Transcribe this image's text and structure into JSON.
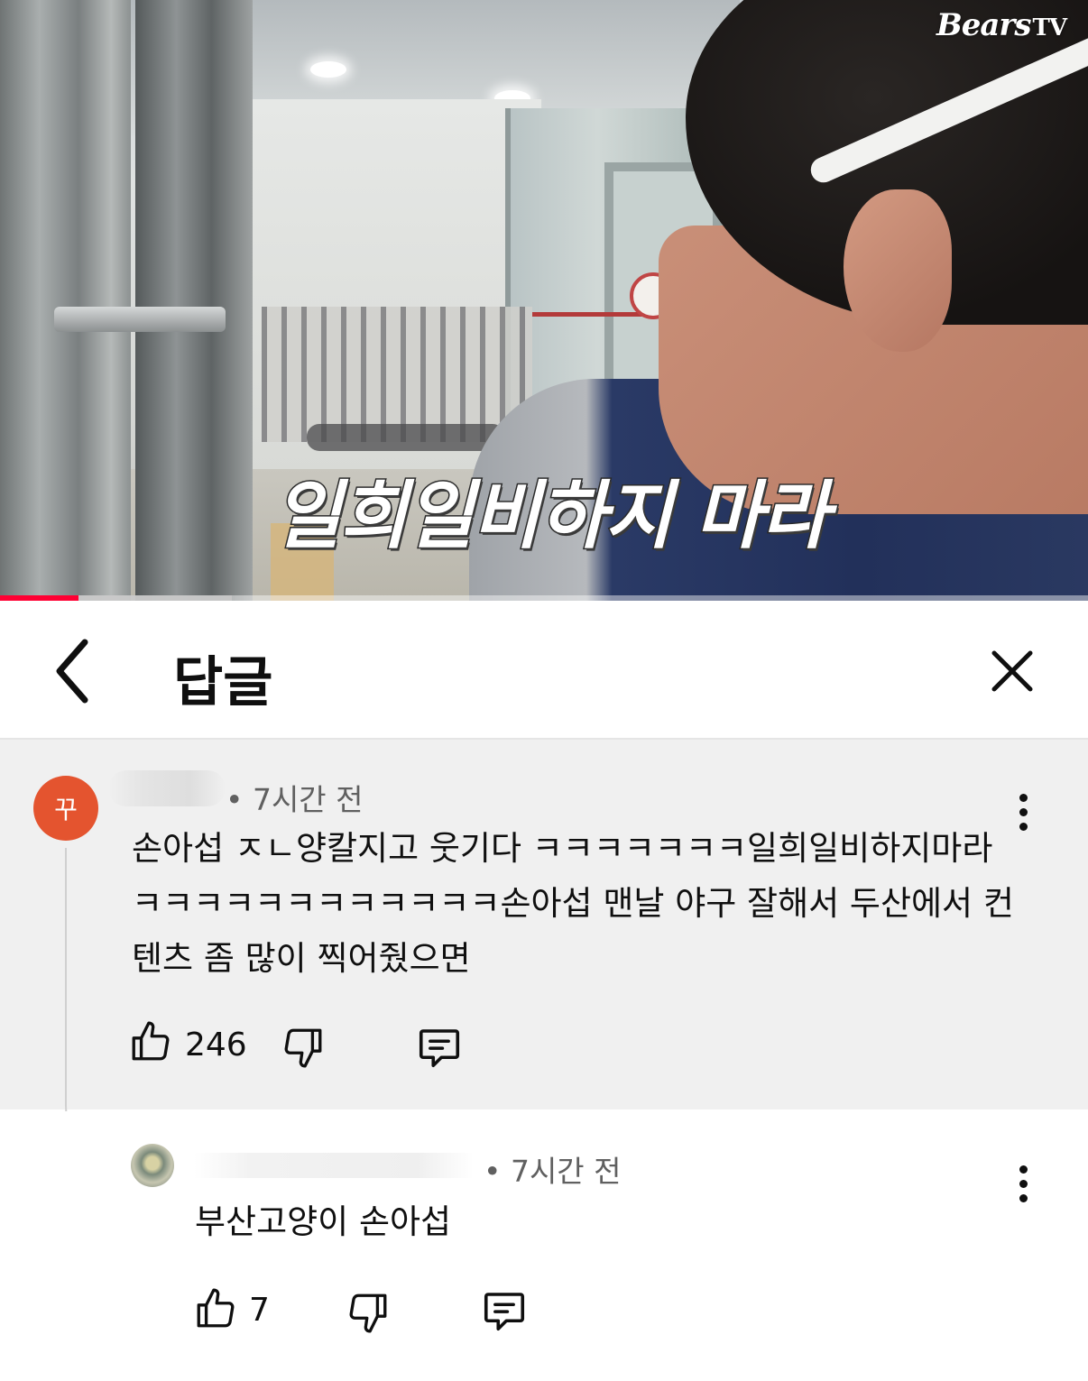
{
  "video": {
    "channel_logo": "Bears",
    "channel_logo_suffix": "TV",
    "subtitle": "일희일비하지 마라",
    "progress": {
      "played_fraction": 0.072,
      "buffered_fraction": 0.213
    }
  },
  "header": {
    "title": "답글",
    "back_icon": "chevron-left-icon",
    "close_icon": "close-icon"
  },
  "parent_comment": {
    "avatar_letter": "꾸",
    "avatar_color": "#e4542f",
    "time": "• 7시간 전",
    "text": "손아섭 ㅈㄴ양칼지고 웃기다 ㅋㅋㅋㅋㅋㅋㅋ일희일비하지마라 ㅋㅋㅋㅋㅋㅋㅋㅋㅋㅋㅋㅋ손아섭 맨날 야구 잘해서 두산에서 컨텐츠 좀 많이 찍어줬으면",
    "likes": "246"
  },
  "reply": {
    "time": "• 7시간 전",
    "text": "부산고양이 손아섭",
    "likes": "7"
  }
}
